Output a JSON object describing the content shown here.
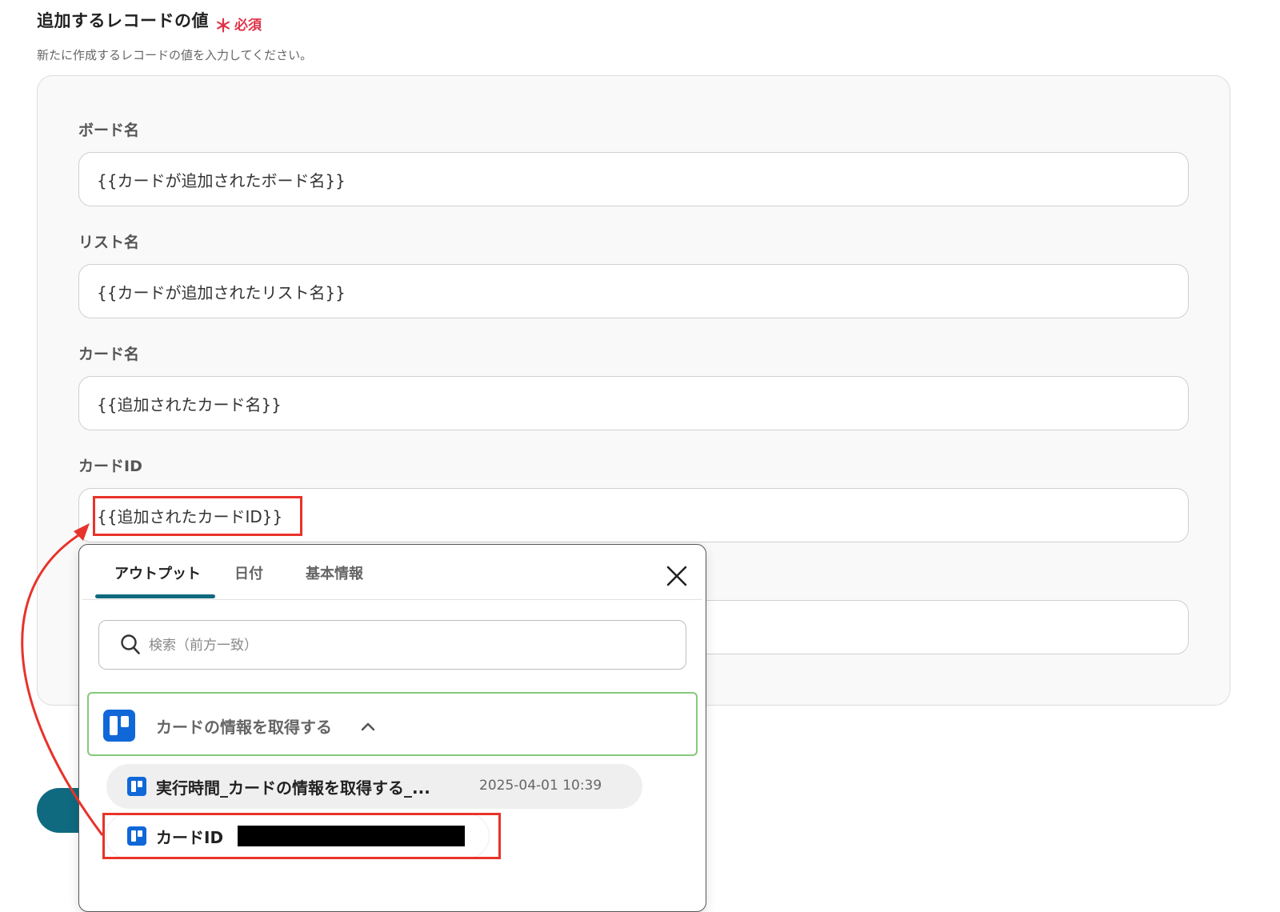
{
  "section": {
    "title": "追加するレコードの値",
    "required_mark": "＊",
    "required_label": "必須",
    "description": "新たに作成するレコードの値を入力してください。"
  },
  "fields": [
    {
      "label": "ボード名",
      "value": "{{カードが追加されたボード名}}"
    },
    {
      "label": "リスト名",
      "value": "{{カードが追加されたリスト名}}"
    },
    {
      "label": "カード名",
      "value": "{{追加されたカード名}}"
    },
    {
      "label": "カードID",
      "value": "{{追加されたカードID}}"
    }
  ],
  "popup": {
    "tabs": [
      {
        "label": "アウトプット",
        "active": true
      },
      {
        "label": "日付",
        "active": false
      },
      {
        "label": "基本情報",
        "active": false
      }
    ],
    "close_icon": "close-icon",
    "search": {
      "placeholder": "検索（前方一致）",
      "icon": "search-icon"
    },
    "group": {
      "title": "カードの情報を取得する",
      "icon": "trello-icon",
      "expanded_icon": "chevron-up-icon"
    },
    "items": [
      {
        "label": "実行時間_カードの情報を取得する_...",
        "timestamp": "2025-04-01 10:39"
      },
      {
        "label": "カードID",
        "value_redacted": true
      }
    ]
  },
  "colors": {
    "accent": "#0f6a80",
    "required": "#e0334a",
    "annotation": "#e8332a",
    "group_border": "#86c97c",
    "trello": "#1068d8"
  }
}
